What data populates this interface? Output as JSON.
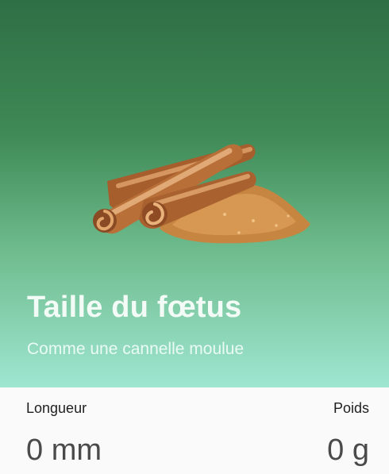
{
  "hero": {
    "image_icon": "cinnamon-sticks-and-powder",
    "title": "Taille du fœtus",
    "subtitle": "Comme une cannelle moulue"
  },
  "stats": {
    "length_label": "Longueur",
    "length_value": "0 mm",
    "weight_label": "Poids",
    "weight_value": "0 g"
  },
  "colors": {
    "hero_gradient_top": "#2f6f45",
    "hero_gradient_bottom": "#9fe6d1",
    "cinnamon": "#b8743f",
    "background": "#fafafa"
  }
}
